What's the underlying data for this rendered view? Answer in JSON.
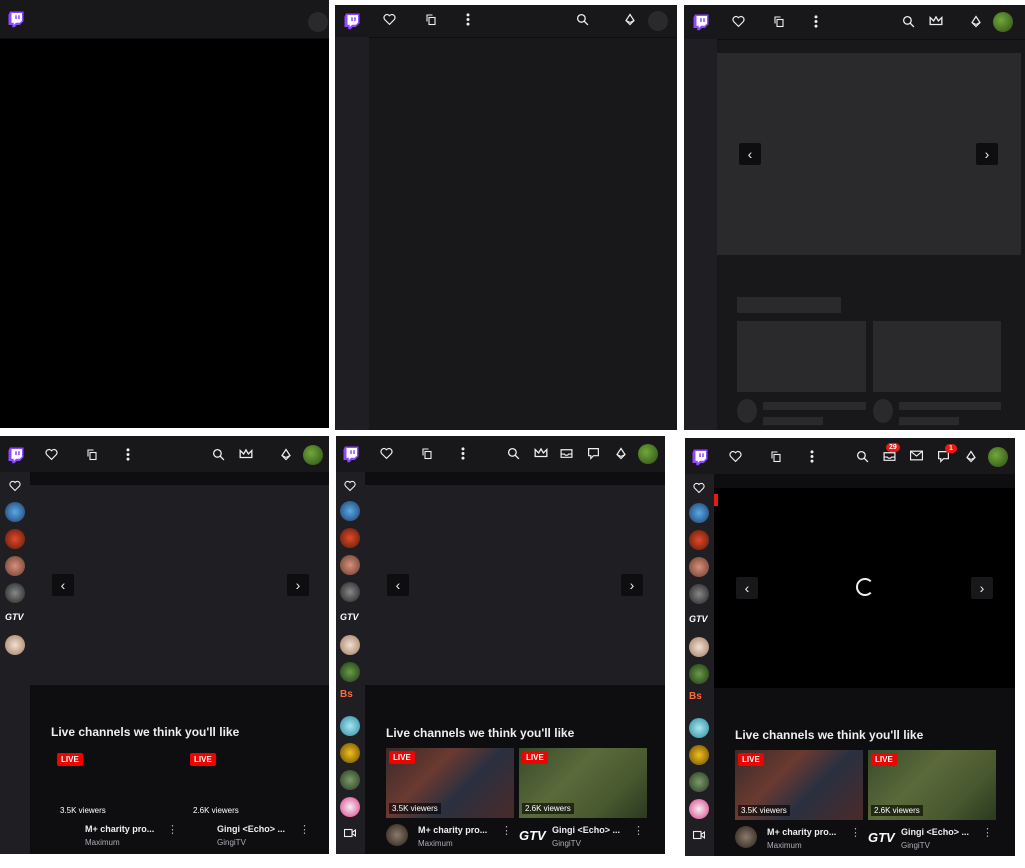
{
  "brand": {
    "accent": "#9147ff",
    "live_red": "#eb0400",
    "background": "#0e0e10",
    "topbar": "#18181b"
  },
  "icons": [
    "twitch-logo-icon",
    "heart-icon",
    "copy-icon",
    "more-vertical-icon",
    "search-icon",
    "crown-icon",
    "inbox-icon",
    "whisper-icon",
    "bits-icon",
    "avatar-icon",
    "video-icon",
    "chevron-left-icon",
    "chevron-right-icon",
    "loading-spinner-icon"
  ],
  "carousel": {
    "prev": "‹",
    "next": "›"
  },
  "section": {
    "title": "Live channels we think you'll like"
  },
  "channels": [
    {
      "live": "LIVE",
      "viewers": "3.5K viewers",
      "title": "M+ charity pro...",
      "name": "Maximum"
    },
    {
      "live": "LIVE",
      "viewers": "2.6K viewers",
      "title": "Gingi <Echo> ...",
      "name": "GingiTV"
    }
  ],
  "badges": {
    "inbox_count": "29",
    "whispers_count": "1"
  },
  "sidebar": {
    "gtv_label": "GTV",
    "bs_label": "Bs"
  },
  "thumb_logo": "GTV"
}
